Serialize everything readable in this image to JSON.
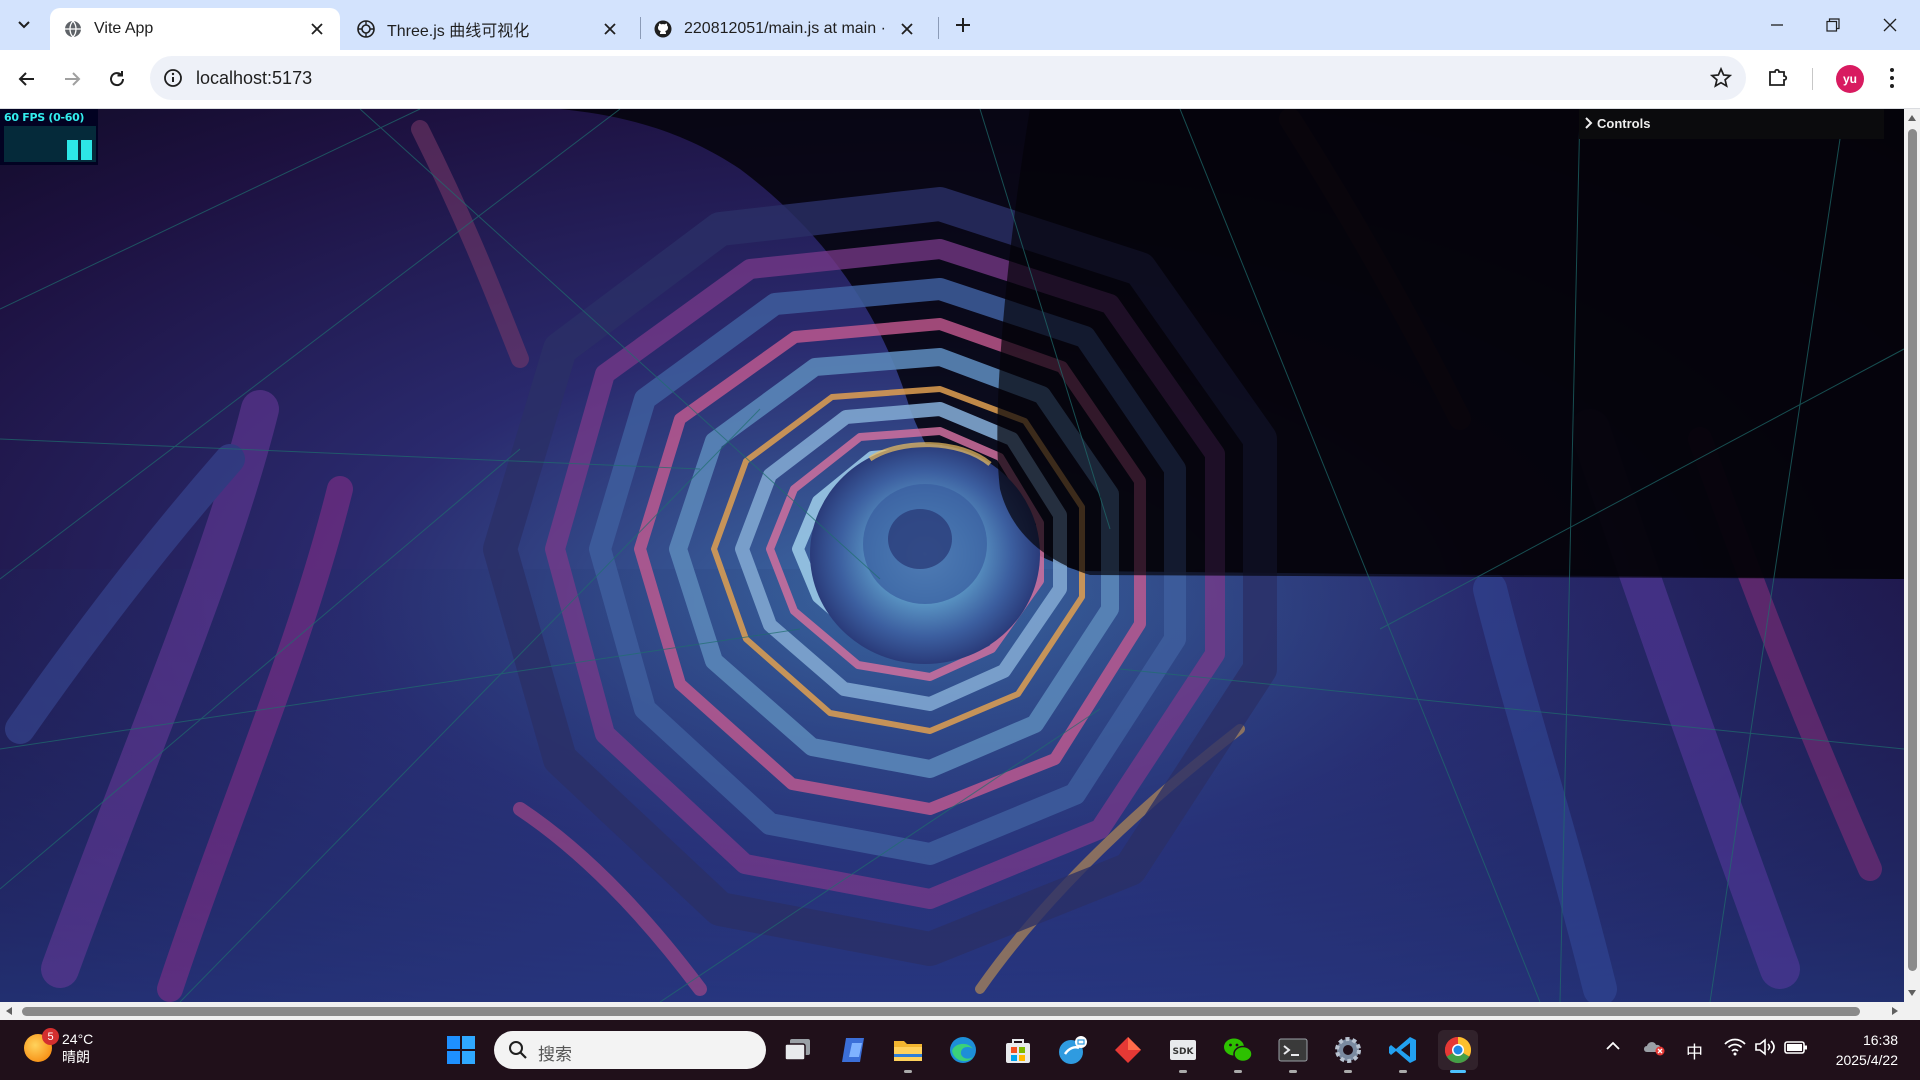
{
  "browser": {
    "tabs": [
      {
        "title": "Vite App",
        "favicon": "globe-icon",
        "active": true
      },
      {
        "title": "Three.js 曲线可视化",
        "favicon": "openai-icon",
        "active": false
      },
      {
        "title": "220812051/main.js at main ·",
        "favicon": "github-icon",
        "active": false
      }
    ],
    "url": "localhost:5173"
  },
  "profile": {
    "initials": "yu",
    "color": "#d81b60"
  },
  "scene": {
    "fps_text": "60 FPS (0-60)",
    "gui_label": "Controls"
  },
  "taskbar": {
    "weather": {
      "badge": "5",
      "temp": "24°C",
      "condition": "晴朗"
    },
    "search_placeholder": "搜索",
    "ime": "中",
    "time": "16:38",
    "date": "2025/4/22"
  },
  "colors": {
    "tabstrip": "#d3e3fd",
    "accent": "#4cc2ff",
    "fps": "#2de6e6"
  }
}
